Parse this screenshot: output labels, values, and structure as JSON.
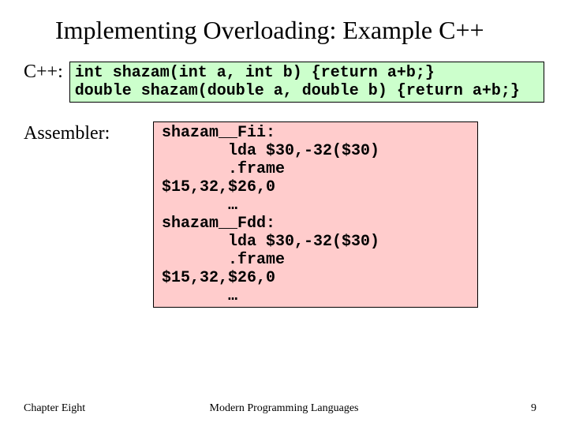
{
  "title": "Implementing Overloading: Example C++",
  "cpp": {
    "label": "C++:",
    "code": "int shazam(int a, int b) {return a+b;}\ndouble shazam(double a, double b) {return a+b;}"
  },
  "asm": {
    "label": "Assembler:",
    "code": "shazam__Fii:\n       lda $30,-32($30)\n       .frame\n$15,32,$26,0\n       …\nshazam__Fdd:\n       lda $30,-32($30)\n       .frame\n$15,32,$26,0\n       …"
  },
  "footer": {
    "chapter": "Chapter Eight",
    "center": "Modern Programming Languages",
    "page": "9"
  }
}
